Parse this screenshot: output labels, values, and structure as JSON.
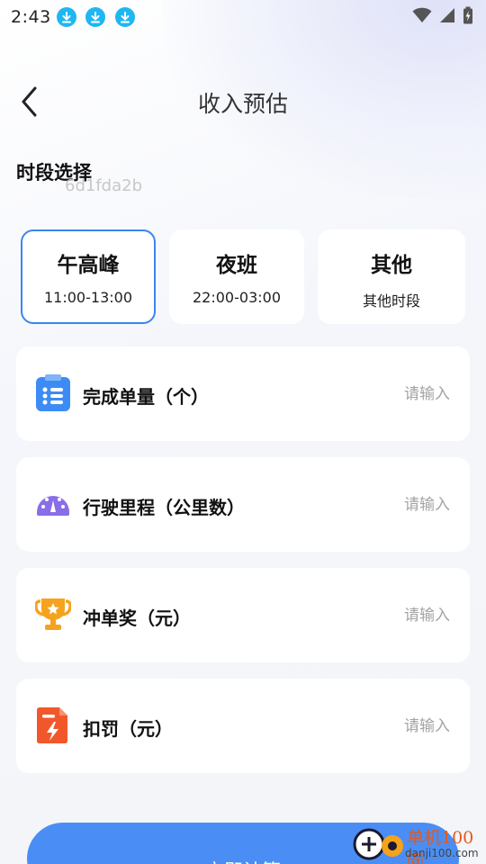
{
  "status_bar": {
    "time": "2:43",
    "download_icons": [
      "download-icon",
      "download-icon",
      "download-icon"
    ],
    "right_icons": [
      "wifi-icon",
      "signal-icon",
      "battery-charging-icon"
    ]
  },
  "header": {
    "title": "收入预估",
    "back_icon": "back-arrow-icon"
  },
  "section": {
    "title": "时段选择",
    "overlay_code": "6d1fda2b"
  },
  "slots": [
    {
      "name": "午高峰",
      "time": "11:00-13:00",
      "selected": true
    },
    {
      "name": "夜班",
      "time": "22:00-03:00",
      "selected": false
    },
    {
      "name": "其他",
      "time": "其他时段",
      "selected": false
    }
  ],
  "inputs": [
    {
      "label": "完成单量（个）",
      "placeholder": "请输入",
      "icon": "clipboard-list-icon",
      "icon_color": "#3d8bf5"
    },
    {
      "label": "行驶里程（公里数）",
      "placeholder": "请输入",
      "icon": "speedometer-icon",
      "icon_color": "#8a6ee8"
    },
    {
      "label": "冲单奖（元）",
      "placeholder": "请输入",
      "icon": "trophy-icon",
      "icon_color": "#f5a31f"
    },
    {
      "label": "扣罚（元）",
      "placeholder": "请输入",
      "icon": "penalty-document-icon",
      "icon_color": "#f2572b"
    }
  ],
  "calc_button": {
    "label": "立即计算"
  },
  "watermark": {
    "name_cn": "单机100网",
    "domain": "danji100.com"
  },
  "colors": {
    "accent": "#3a86f0",
    "button": "#4a8ef5",
    "status_download": "#1fb7f2"
  }
}
